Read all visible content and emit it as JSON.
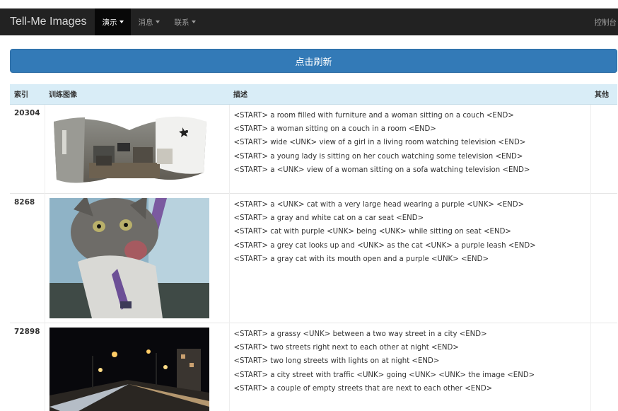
{
  "navbar": {
    "brand": "Tell-Me Images",
    "items": [
      {
        "label": "演示",
        "active": true
      },
      {
        "label": "消息",
        "active": false
      },
      {
        "label": "联系",
        "active": false
      }
    ],
    "right_label": "控制台"
  },
  "refresh_button": "点击刷新",
  "table": {
    "headers": [
      "索引",
      "训练图像",
      "描述",
      "其他"
    ],
    "rows": [
      {
        "index": "20304",
        "image": "panorama-living-room",
        "captions": [
          "<START> a room filled with furniture and a woman sitting on a couch <END>",
          "<START> a woman sitting on a couch in a room <END>",
          "<START> wide <UNK> view of a girl in a living room watching television <END>",
          "<START> a young lady is sitting on her couch watching some television <END>",
          "<START> a <UNK> view of a woman sitting on a sofa watching television <END>"
        ]
      },
      {
        "index": "8268",
        "image": "gray-cat-car-seat",
        "captions": [
          "<START> a <UNK> cat with a very large head wearing a purple <UNK> <END>",
          "<START> a gray and white cat on a car seat <END>",
          "<START> cat with purple <UNK> being <UNK> while sitting on seat <END>",
          "<START> a grey cat looks up and <UNK> as the cat <UNK> a purple leash <END>",
          "<START> a gray cat with its mouth open and a purple <UNK> <END>"
        ]
      },
      {
        "index": "72898",
        "image": "night-street",
        "captions": [
          "<START> a grassy <UNK> between a two way street in a city <END>",
          "<START> two streets right next to each other at night <END>",
          "<START> two long streets with lights on at night <END>",
          "<START> a city street with traffic <UNK> going <UNK> <UNK> the image <END>",
          "<START> a couple of empty streets that are next to each other <END>"
        ]
      }
    ]
  }
}
